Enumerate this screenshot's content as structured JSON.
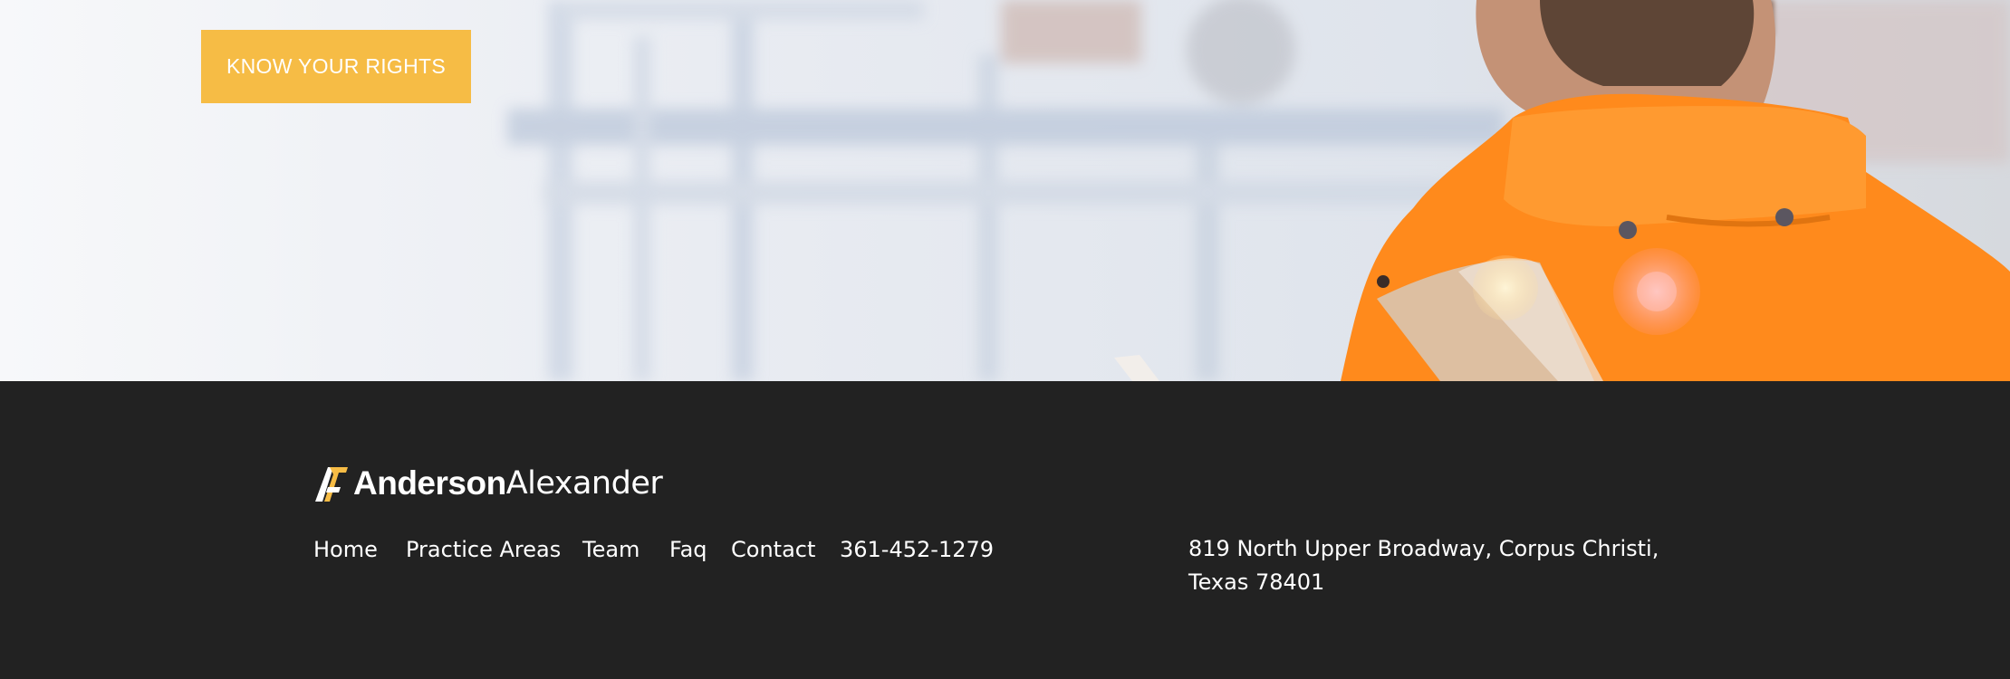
{
  "hero": {
    "cta_label": "KNOW YOUR RIGHTS",
    "colors": {
      "cta": "#f6bc45",
      "jacket": "#ff8a1c",
      "background": "#eef0f4"
    }
  },
  "footer": {
    "brand": {
      "name_bold": "Anderson",
      "name_light": "Alexander",
      "mark_color": "#f6bc45"
    },
    "nav": {
      "items": [
        {
          "label": "Home"
        },
        {
          "label": "Practice Areas"
        },
        {
          "label": "Team"
        },
        {
          "label": "Faq"
        },
        {
          "label": "Contact"
        },
        {
          "label": "361-452-1279"
        }
      ]
    },
    "address": {
      "line1": "819 North Upper Broadway, Corpus Christi,",
      "line2": "Texas 78401"
    },
    "background": "#222222"
  }
}
